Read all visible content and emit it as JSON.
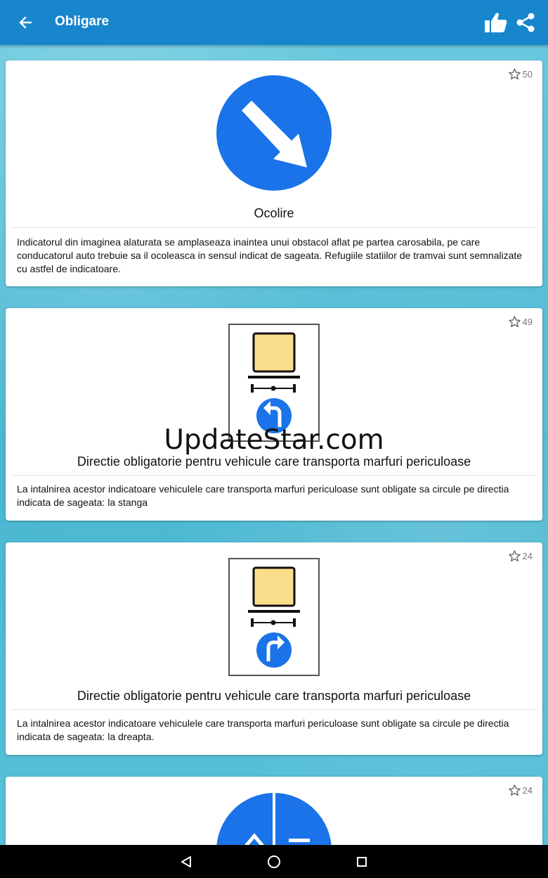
{
  "appbar": {
    "title": "Obligare",
    "back_icon": "arrow-left-icon",
    "like_icon": "thumbs-up-icon",
    "share_icon": "share-icon"
  },
  "cards": [
    {
      "favorites": "50",
      "sign": "keep-right-arrow-sign",
      "title": "Ocolire",
      "description": "Indicatorul din imaginea alaturata se amplaseaza inaintea unui obstacol aflat pe partea carosabila, pe care conducatorul auto trebuie sa il ocoleasca in sensul indicat de sageata. Refugiile statiilor de tramvai sunt semnalizate cu astfel de indicatoare."
    },
    {
      "favorites": "49",
      "sign": "dangerous-goods-turn-left-sign",
      "title": "Directie obligatorie pentru vehicule care transporta marfuri periculoase",
      "description": "La intalnirea acestor indicatoare vehiculele care transporta marfuri periculoase sunt obligate sa circule pe directia indicata de sageata: la stanga"
    },
    {
      "favorites": "24",
      "sign": "dangerous-goods-turn-right-sign",
      "title": "Directie obligatorie pentru vehicule care transporta marfuri periculoase",
      "description": "La intalnirea acestor indicatoare vehiculele care transporta marfuri periculoase sunt obligate sa circule pe directia indicata de sageata: la dreapta."
    },
    {
      "favorites": "24",
      "sign": "split-path-sign"
    }
  ],
  "watermark": "UpdateStar.com",
  "navbar": {
    "back_icon": "nav-back-icon",
    "home_icon": "nav-home-icon",
    "recents_icon": "nav-recents-icon"
  },
  "colors": {
    "appbar": "#1786cd",
    "sign_blue": "#1a73e8",
    "cargo_yellow": "#fadd8a"
  }
}
